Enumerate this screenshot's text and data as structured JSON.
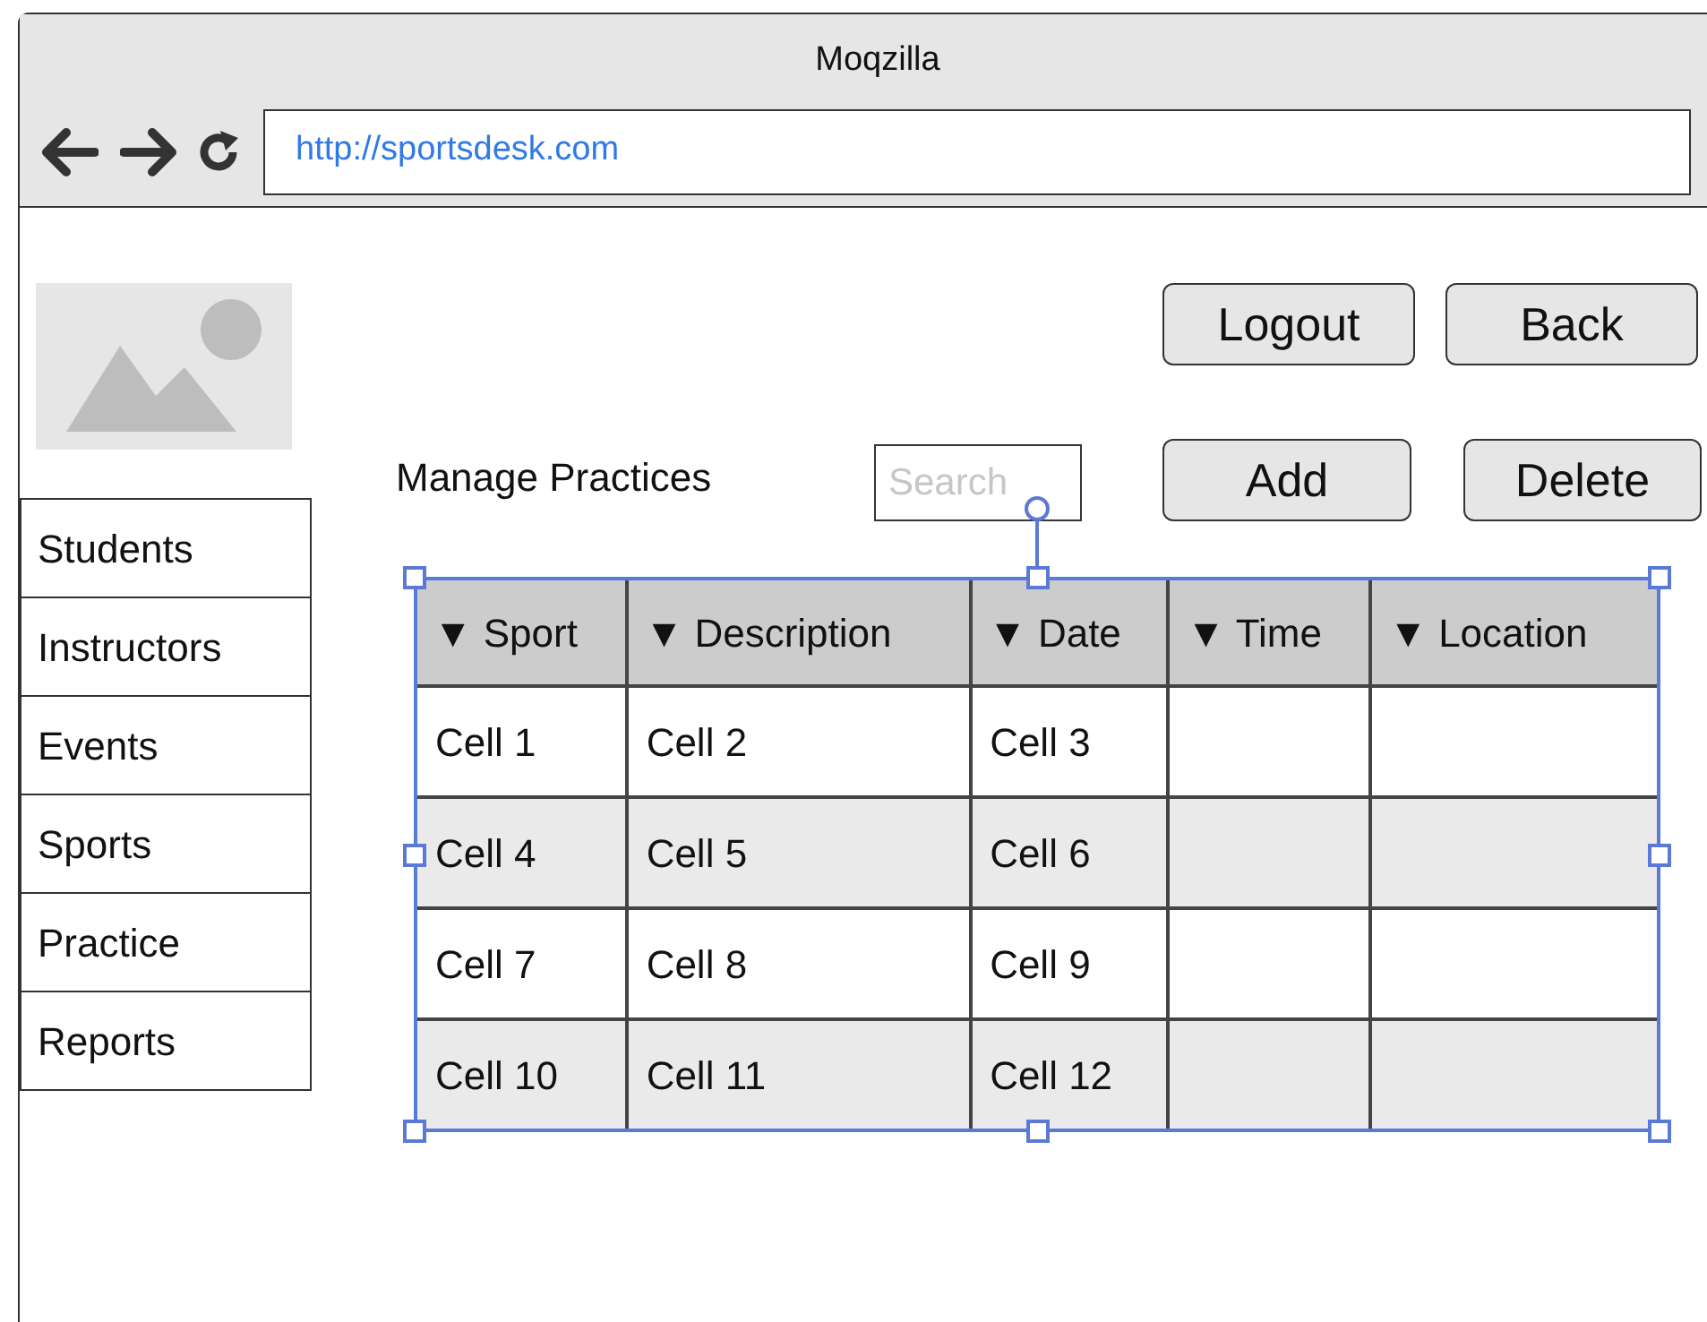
{
  "window": {
    "title": "Moqzilla"
  },
  "address_bar": {
    "value": "http://sportsdesk.com"
  },
  "sidebar": {
    "items": [
      {
        "label": "Students"
      },
      {
        "label": "Instructors"
      },
      {
        "label": "Events"
      },
      {
        "label": "Sports"
      },
      {
        "label": "Practice"
      },
      {
        "label": "Reports"
      }
    ]
  },
  "top_buttons": [
    "Logout",
    "Back"
  ],
  "heading": "Manage Practices",
  "search": {
    "placeholder": "Search"
  },
  "action_buttons": [
    "Add",
    "Delete"
  ],
  "table": {
    "columns": [
      "▼ Sport",
      "▼ Description",
      "▼ Date",
      "▼ Time",
      "▼ Location"
    ],
    "rows": [
      [
        "Cell 1",
        "Cell 2",
        "Cell 3"
      ],
      [
        "Cell 4",
        "Cell 5",
        "Cell 6"
      ],
      [
        "Cell 7",
        "Cell 8",
        "Cell 9"
      ],
      [
        "Cell 10",
        "Cell 11",
        "Cell 12"
      ]
    ]
  }
}
